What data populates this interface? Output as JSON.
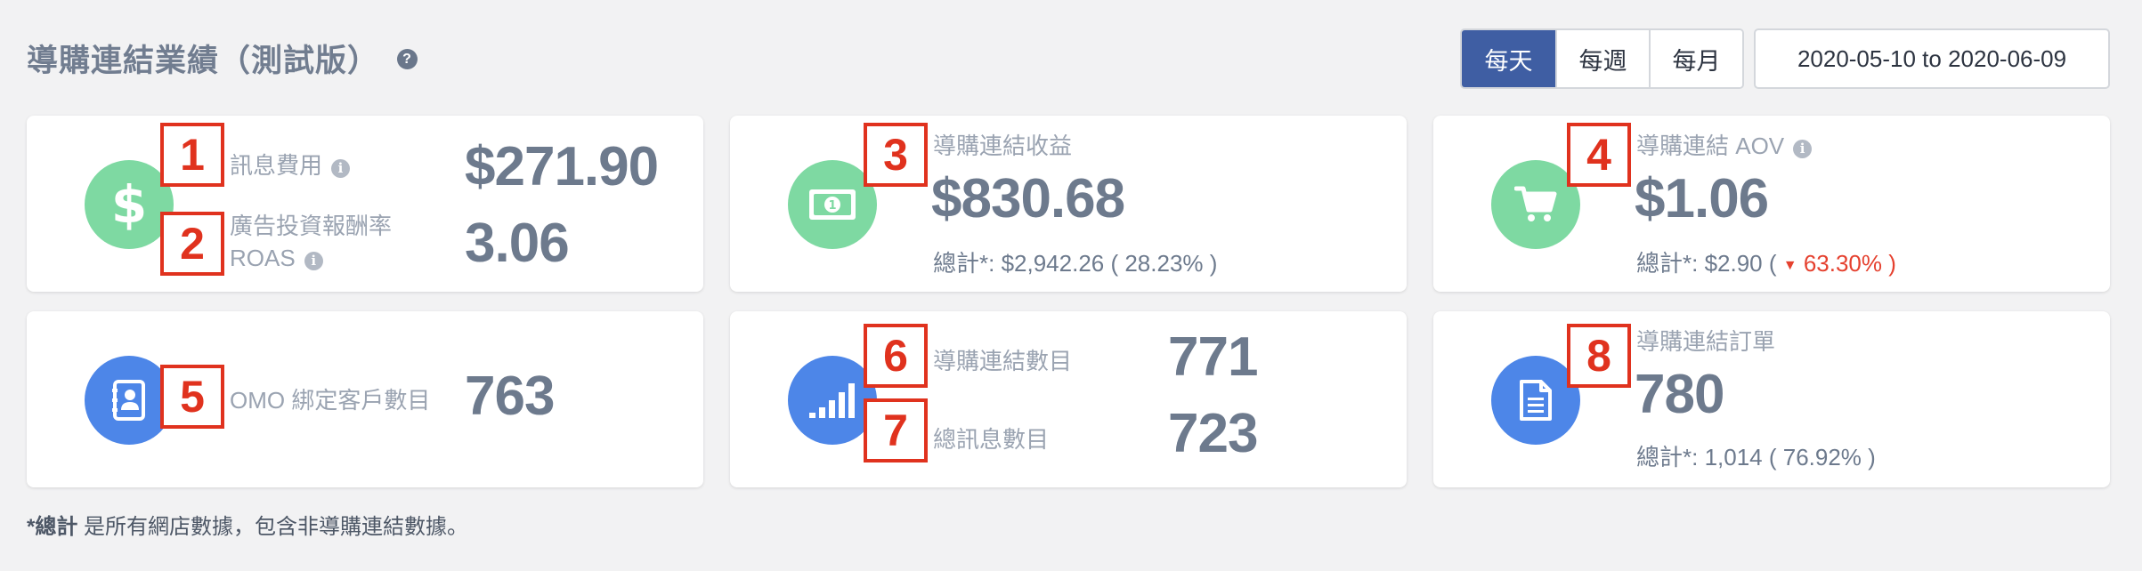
{
  "header": {
    "title": "導購連結業績（測試版）",
    "help_icon": "?",
    "periods": [
      "每天",
      "每週",
      "每月"
    ],
    "active_period": "每天",
    "date_range": "2020-05-10 to 2020-06-09"
  },
  "cards": {
    "c1": {
      "icon": "dollar-icon",
      "badges": [
        "1",
        "2"
      ],
      "label1": "訊息費用",
      "value1": "$271.90",
      "label2a": "廣告投資報酬率",
      "label2b": "ROAS",
      "value2": "3.06"
    },
    "c2": {
      "icon": "banknote-icon",
      "badge": "3",
      "label": "導購連結收益",
      "value": "$830.68",
      "total": "總計*: $2,942.26 ( 28.23% )"
    },
    "c3": {
      "icon": "cart-icon",
      "badge": "4",
      "label": "導購連結 AOV",
      "value": "$1.06",
      "total_prefix": "總計*: $2.90 (",
      "change": "63.30% )"
    },
    "c4": {
      "icon": "contact-book-icon",
      "badge": "5",
      "label": "OMO 綁定客戶數目",
      "value": "763"
    },
    "c5": {
      "icon": "signal-bars-icon",
      "badges": [
        "6",
        "7"
      ],
      "label1": "導購連結數目",
      "value1": "771",
      "label2": "總訊息數目",
      "value2": "723"
    },
    "c6": {
      "icon": "document-icon",
      "badge": "8",
      "label": "導購連結訂單",
      "value": "780",
      "total": "總計*: 1,014 ( 76.92% )"
    }
  },
  "footnote": {
    "bold": "*總計",
    "text": " 是所有網店數據，包含非導購連結數據。"
  },
  "colors": {
    "accent": "#3f5ea3",
    "green_icon": "#7ed9a2",
    "blue_icon": "#4d86e8",
    "annotation_red": "#e0321e",
    "negative": "#e5412f"
  }
}
